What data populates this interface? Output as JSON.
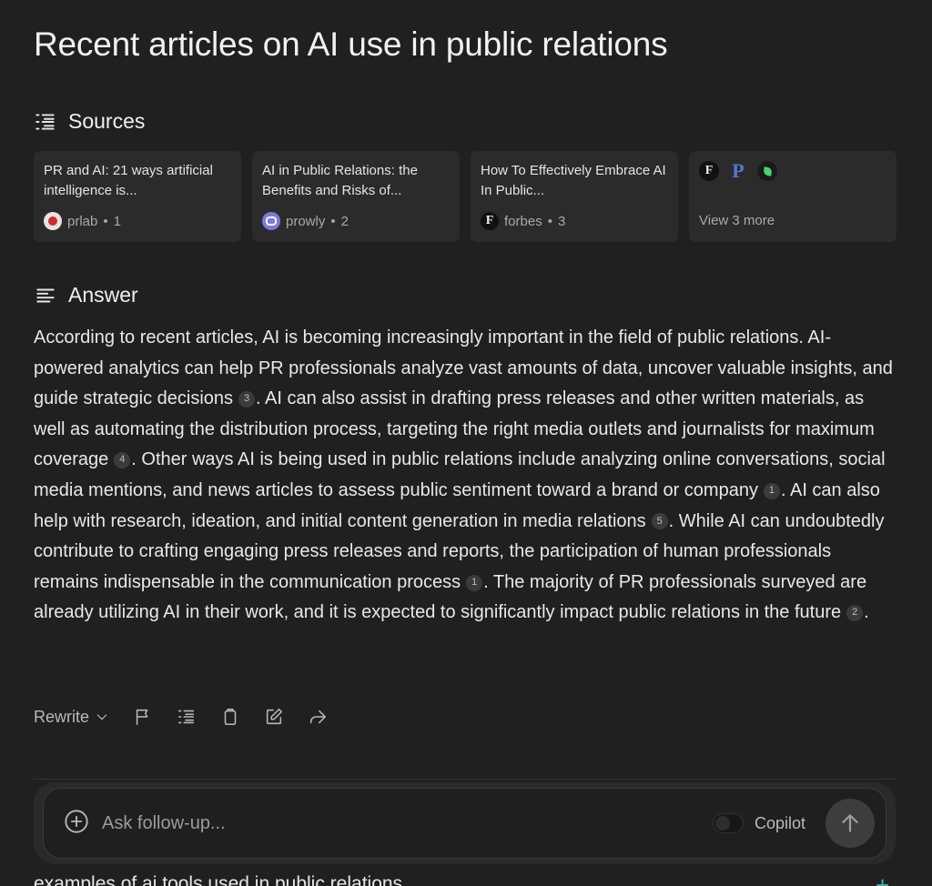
{
  "title": "Recent articles on AI use in public relations",
  "sources": {
    "heading": "Sources",
    "cards": [
      {
        "title": "PR and AI: 21 ways artificial intelligence is...",
        "site": "prlab",
        "index": "1"
      },
      {
        "title": "AI in Public Relations: the Benefits and Risks of...",
        "site": "prowly",
        "index": "2"
      },
      {
        "title": "How To Effectively Embrace AI In Public...",
        "site": "forbes",
        "index": "3"
      }
    ],
    "more_label": "View 3 more",
    "more_icons": [
      "forbes-icon",
      "p-icon",
      "leaf-icon"
    ],
    "separator": "•"
  },
  "answer": {
    "heading": "Answer",
    "segments": [
      {
        "text": "According to recent articles, AI is becoming increasingly important in the field of public relations. AI-powered analytics can help PR professionals analyze vast amounts of data, uncover valuable insights, and guide strategic decisions",
        "cite": "3"
      },
      {
        "text": ". AI can also assist in drafting press releases and other written materials, as well as automating the distribution process, targeting the right media outlets and journalists for maximum coverage",
        "cite": "4"
      },
      {
        "text": ". Other ways AI is being used in public relations include analyzing online conversations, social media mentions, and news articles to assess public sentiment toward a brand or company",
        "cite": "1"
      },
      {
        "text": ". AI can also help with research, ideation, and initial content generation in media relations",
        "cite": "5"
      },
      {
        "text": ". While AI can undoubtedly contribute to crafting engaging press releases and reports, the participation of human professionals remains indispensable in the communication process",
        "cite": "1"
      },
      {
        "text": ". The majority of PR professionals surveyed are already utilizing AI in their work, and it is expected to significantly impact public relations in the future",
        "cite": "2"
      },
      {
        "text": ".",
        "cite": null
      }
    ]
  },
  "actions": {
    "rewrite_label": "Rewrite",
    "icons": [
      "flag-icon",
      "sources-icon",
      "clipboard-icon",
      "edit-icon",
      "share-icon"
    ]
  },
  "followup": {
    "placeholder": "Ask follow-up...",
    "copilot_label": "Copilot",
    "copilot_enabled": false
  },
  "related": {
    "first_item": "examples of ai tools used in public relations"
  }
}
